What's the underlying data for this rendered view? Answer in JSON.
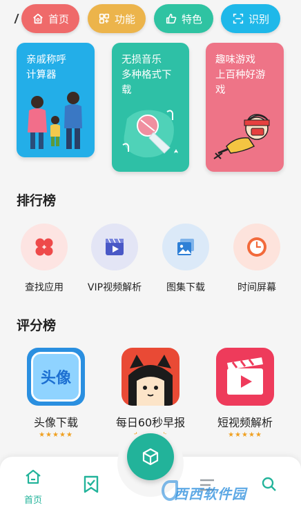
{
  "top_nav": [
    {
      "label": "首页",
      "icon": "home-icon",
      "color": "#ef6a6a"
    },
    {
      "label": "功能",
      "icon": "grid-icon",
      "color": "#ecb44b"
    },
    {
      "label": "特色",
      "icon": "thumbs-up-icon",
      "color": "#2fc3a2"
    },
    {
      "label": "识别",
      "icon": "scan-icon",
      "color": "#1fb8e9"
    }
  ],
  "cards": [
    {
      "text": "亲戚称呼\n计算器",
      "color": "#23aee8"
    },
    {
      "text": "无损音乐\n多种格式下\n载",
      "color": "#2ec0a6"
    },
    {
      "text": "趣味游戏\n上百种好游\n戏",
      "color": "#ee7487"
    }
  ],
  "ranking": {
    "title": "排行榜",
    "items": [
      {
        "label": "查找应用",
        "icon": "clover-icon"
      },
      {
        "label": "VIP视频解析",
        "icon": "video-play-icon"
      },
      {
        "label": "图集下载",
        "icon": "gallery-icon"
      },
      {
        "label": "时间屏幕",
        "icon": "clock-icon"
      }
    ]
  },
  "rating": {
    "title": "评分榜",
    "items": [
      {
        "name": "头像下载",
        "icon_text": "头像",
        "stars": "★★★★★"
      },
      {
        "name": "每日60秒早报",
        "stars": "★★★★★"
      },
      {
        "name": "短视频解析",
        "stars": "★★★★★"
      }
    ]
  },
  "bottom_nav": {
    "home_label": "首页"
  },
  "watermark": "西西软件园"
}
